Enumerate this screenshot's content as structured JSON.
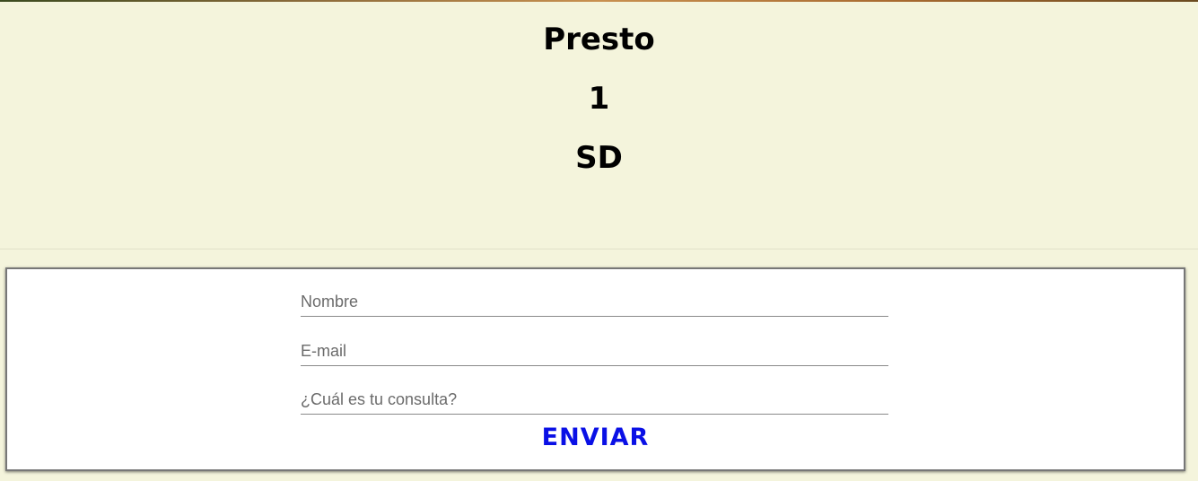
{
  "header": {
    "title": "Presto",
    "number": "1",
    "code": "SD"
  },
  "form": {
    "name_placeholder": "Nombre",
    "email_placeholder": "E-mail",
    "query_placeholder": "¿Cuál es tu consulta?",
    "submit_label": "ENVIAR"
  },
  "colors": {
    "background": "#f4f4dc",
    "submit_text": "#0a10e6"
  }
}
